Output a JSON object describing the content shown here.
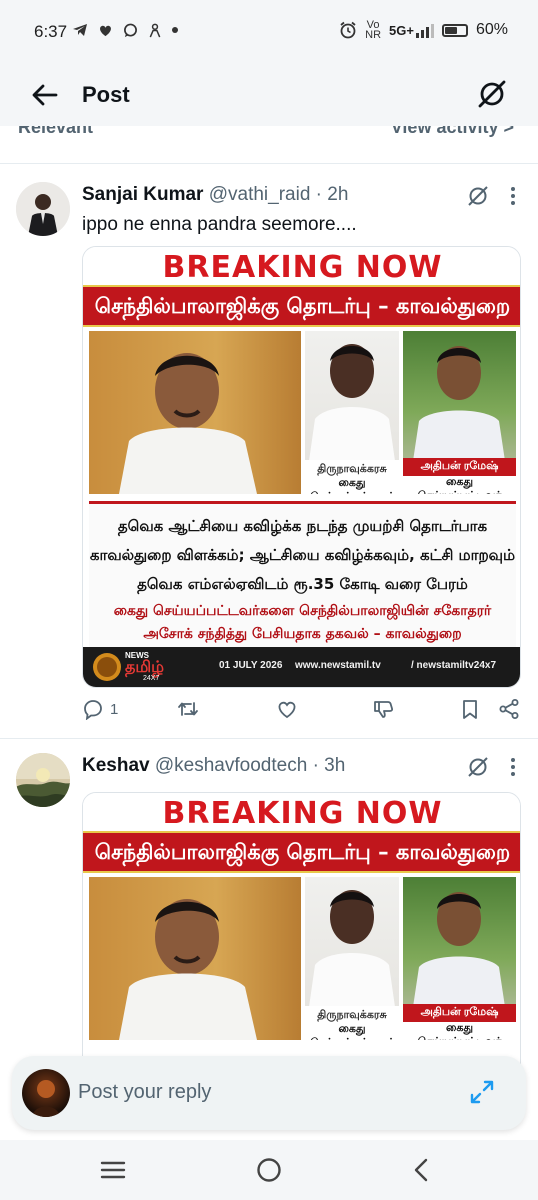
{
  "status_bar": {
    "time": "6:37",
    "left_icons": [
      "telegram-icon",
      "heart-icon",
      "chat-icon",
      "person-icon",
      "dot-icon"
    ],
    "right_icons": [
      "alarm-icon",
      "volte-icon",
      "5g-signal-icon",
      "battery-icon"
    ],
    "volte_top": "Vo",
    "volte_bottom": "NR",
    "network": "5G+",
    "battery_pct": "60%",
    "battery_level": 0.6
  },
  "app_bar": {
    "title": "Post"
  },
  "clipped_header": {
    "left": "Relevant",
    "right": "View activity >"
  },
  "posts": [
    {
      "author_name": "Sanjai Kumar",
      "author_handle": "@vathi_raid",
      "separator": "·",
      "time": "2h",
      "text": "ippo ne enna pandra seemore....",
      "image": {
        "breaking": "BREAKING NOW",
        "headline": "செந்தில்பாலாஜிக்கு தொடர்பு – காவல்துறை",
        "caption_mid_name": "திருநாவுக்கரசு",
        "caption_mid_role": "கைது செய்யப்பட்டவர்",
        "caption_right_name": "அதிபன் ரமேஷ்",
        "caption_right_role": "கைது செய்யப்பட்டவர்",
        "line1": "தவெக ஆட்சியை கவிழ்க்க நடந்த முயற்சி தொடர்பாக",
        "line2": "காவல்துறை விளக்கம்; ஆட்சியை கவிழ்க்கவும், கட்சி மாறவும்",
        "line3": "தவெக எம்எல்ஏவிடம் ரூ.35 கோடி வரை பேரம்",
        "line4": "கைது செய்யப்பட்டவர்களை செந்தில்பாலாஜியின் சகோதரர்",
        "line5": "அசோக் சந்தித்து பேசியதாக தகவல் – காவல்துறை",
        "logo_news": "NEWS",
        "logo_tamil": "தமிழ்",
        "logo_247": "24X7",
        "date": "01 JULY 2026",
        "site": "www.newstamil.tv",
        "handle": "/ newstamiltv24x7"
      },
      "reply_count": "1"
    },
    {
      "author_name": "Keshav",
      "author_handle": "@keshavfoodtech",
      "separator": "·",
      "time": "3h",
      "image": {
        "breaking": "BREAKING NOW",
        "headline": "செந்தில்பாலாஜிக்கு தொடர்பு – காவல்துறை",
        "caption_mid_name": "திருநாவுக்கரசு",
        "caption_mid_role": "கைது செய்யப்பட்டவர்",
        "caption_right_name": "அதிபன் ரமேஷ்",
        "caption_right_role": "கைது செய்யப்பட்டவர்"
      }
    }
  ],
  "reply_bar": {
    "placeholder": "Post your reply"
  },
  "nav_bar": {
    "buttons": [
      "recent-apps-icon",
      "home-icon",
      "back-nav-icon"
    ]
  },
  "colors": {
    "accent_red": "#c0161c",
    "text_primary": "#0f1419",
    "text_secondary": "#536471",
    "chrome_bg": "#f4f6f8"
  }
}
